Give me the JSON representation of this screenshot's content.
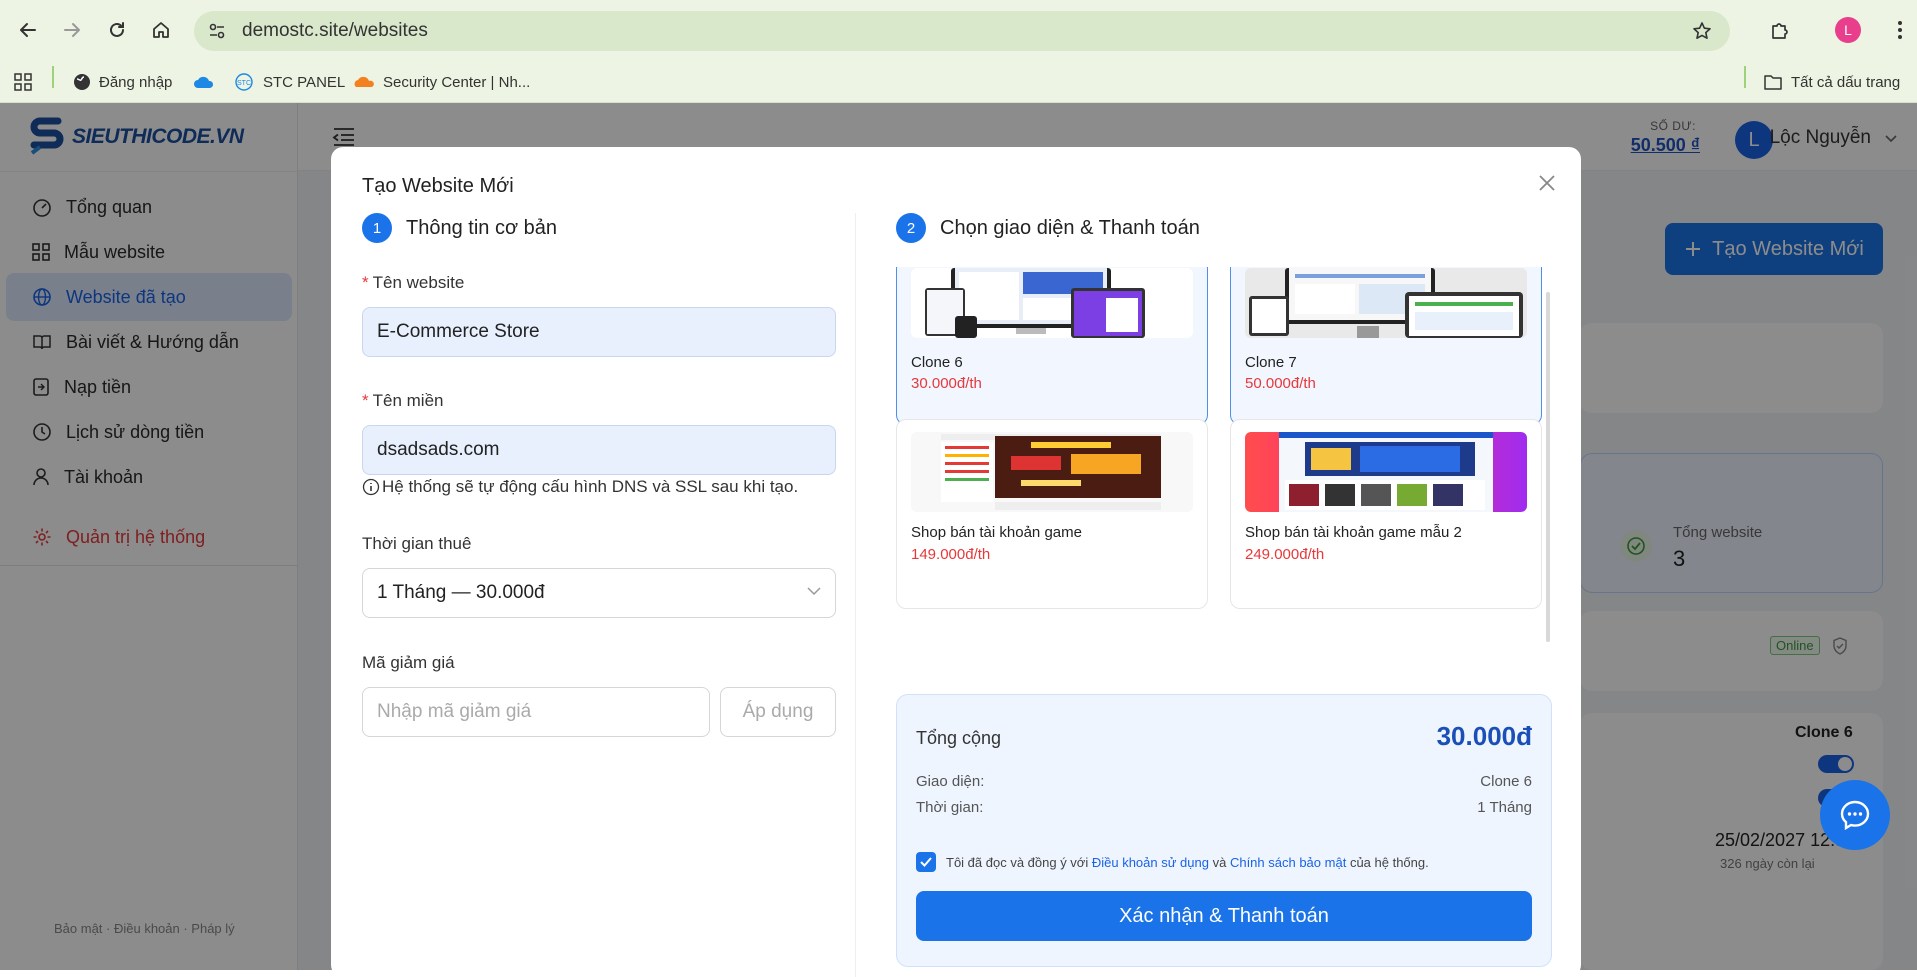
{
  "browser": {
    "url": "demostc.site/websites",
    "profile_initial": "L",
    "bookmarks": [
      {
        "label": "Đăng nhập",
        "icon": "globe-icon"
      },
      {
        "label": "",
        "icon": "cloud-icon"
      },
      {
        "label": "STC PANEL",
        "icon": "stc-icon"
      },
      {
        "label": "Security Center | Nh...",
        "icon": "cloudflare-icon"
      }
    ],
    "all_bookmarks_label": "Tất cả dấu trang"
  },
  "sidebar": {
    "logo_text": "SIEUTHICODE.VN",
    "items": [
      {
        "label": "Tổng quan",
        "icon": "dashboard-icon"
      },
      {
        "label": "Mẫu website",
        "icon": "grid-icon"
      },
      {
        "label": "Website đã tạo",
        "icon": "globe-icon",
        "active": true
      },
      {
        "label": "Bài viết & Hướng dẫn",
        "icon": "book-icon"
      },
      {
        "label": "Nạp tiền",
        "icon": "deposit-icon"
      },
      {
        "label": "Lịch sử dòng tiền",
        "icon": "history-icon"
      },
      {
        "label": "Tài khoản",
        "icon": "user-icon"
      }
    ],
    "admin_label": "Quản trị hệ thống",
    "footer": "Bảo mật · Điều khoản · Pháp lý"
  },
  "topbar": {
    "balance_label": "SỐ DƯ:",
    "balance_value": "50.500 ₫",
    "user_initial": "L",
    "user_name": "Lộc Nguyễn"
  },
  "background": {
    "create_button": "Tạo Website Mới",
    "stat_label": "Tổng website",
    "stat_value": "3",
    "online_badge": "Online",
    "site_name": "Clone 6",
    "expiry_date": "25/02/2027 12:52",
    "days_left": "326 ngày còn lại"
  },
  "modal": {
    "title": "Tạo Website Mới",
    "step1": {
      "num": "1",
      "label": "Thông tin cơ bản"
    },
    "step2": {
      "num": "2",
      "label": "Chọn giao diện & Thanh toán"
    },
    "website_name_label": "Tên website",
    "website_name_value": "E-Commerce Store",
    "domain_label": "Tên miền",
    "domain_value": "dsadsads.com",
    "domain_hint": "Hệ thống sẽ tự động cấu hình DNS và SSL sau khi tạo.",
    "duration_label": "Thời gian thuê",
    "duration_value": "1 Tháng — 30.000đ",
    "coupon_label": "Mã giảm giá",
    "coupon_placeholder": "Nhập mã giảm giá",
    "apply_label": "Áp dụng",
    "templates": [
      {
        "name": "Clone 6",
        "price": "30.000đ/th",
        "selected": true
      },
      {
        "name": "Clone 7",
        "price": "50.000đ/th",
        "selected": false
      },
      {
        "name": "Shop bán tài khoản game",
        "price": "149.000đ/th",
        "selected": false
      },
      {
        "name": "Shop bán tài khoản game mẫu 2",
        "price": "249.000đ/th",
        "selected": false
      }
    ],
    "summary": {
      "title": "Tổng cộng",
      "total": "30.000đ",
      "theme_label": "Giao diện:",
      "theme_value": "Clone 6",
      "time_label": "Thời gian:",
      "time_value": "1 Tháng",
      "agree_prefix": "Tôi đã đọc và đồng ý với",
      "terms_link": "Điều khoản sử dụng",
      "agree_and": "và",
      "privacy_link": "Chính sách bảo mật",
      "agree_suffix": "của hệ thống.",
      "agree_checked": true,
      "confirm_label": "Xác nhận & Thanh toán"
    }
  },
  "colors": {
    "primary": "#1a73e8",
    "danger": "#e5393b",
    "chrome_bg": "#edf4e3"
  }
}
